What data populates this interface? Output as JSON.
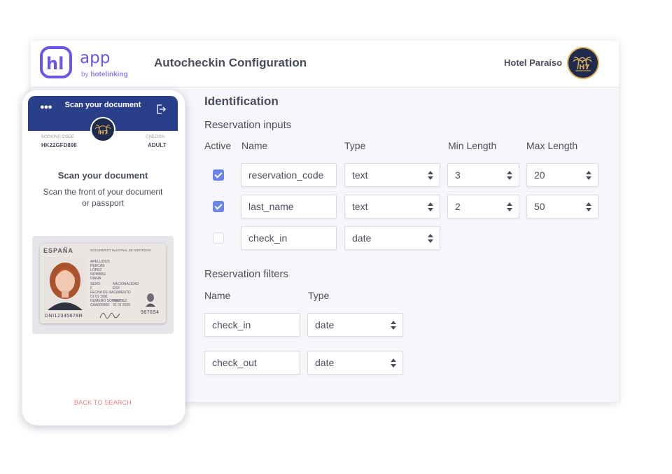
{
  "brand": {
    "app_label": "app",
    "by_prefix": "by ",
    "by_name": "hotelinking"
  },
  "header": {
    "title": "Autocheckin Configuration",
    "hotel_name": "Hotel Paraíso",
    "hotel_logo_icon": "palm-trees-logo-icon"
  },
  "identification": {
    "title": "Identification",
    "inputs_title": "Reservation inputs",
    "columns": [
      "Active",
      "Name",
      "Type",
      "Min Length",
      "Max Length"
    ],
    "rows": [
      {
        "active": true,
        "name": "reservation_code",
        "type": "text",
        "min": "3",
        "max": "20"
      },
      {
        "active": true,
        "name": "last_name",
        "type": "text",
        "min": "2",
        "max": "50"
      },
      {
        "active": false,
        "name": "check_in",
        "type": "date"
      }
    ],
    "filters_title": "Reservation filters",
    "filter_columns": [
      "Name",
      "Type"
    ],
    "filters": [
      {
        "name": "check_in",
        "type": "date"
      },
      {
        "name": "check_out",
        "type": "date"
      }
    ]
  },
  "phone": {
    "top_title": "Scan your document",
    "menu_icon": "more-dots-icon",
    "exit_icon": "exit-icon",
    "booking_label": "BOOKING CODE",
    "booking_code": "HK22GFD898",
    "checkin_label": "CHECKIN",
    "checkin_value": "ADULT",
    "scan_title": "Scan your document",
    "scan_desc": "Scan the front of your document or passport",
    "id_card": {
      "country": "ESPAÑA",
      "doc_title": "DOCUMENTO NACIONAL DE IDENTIDAD",
      "apellidos_label": "APELLIDOS",
      "apellido1": "PERCÁS",
      "apellido2": "LÓPEZ",
      "nombre_label": "NOMBRE",
      "nombre": "DIANA",
      "sexo_label": "SEXO",
      "sexo": "F",
      "nacionalidad_label": "NACIONALIDAD",
      "nacionalidad": "ESP",
      "fecha_label": "FECHA DE NACIMIENTO",
      "fecha": "01 01 1991",
      "soporte_label": "NUMERO SOPORT",
      "soporte": "CAA000000",
      "validez_label": "VALIDEZ",
      "validez": "01 01 2025",
      "dni": "DNI12345678R",
      "code": "987654"
    },
    "back_link": "BACK TO SEARCH"
  },
  "colors": {
    "accent": "#6a55e6",
    "phone_header": "#2a3f8a",
    "checkbox_on": "#6a84e8",
    "back_link": "#e68080"
  }
}
